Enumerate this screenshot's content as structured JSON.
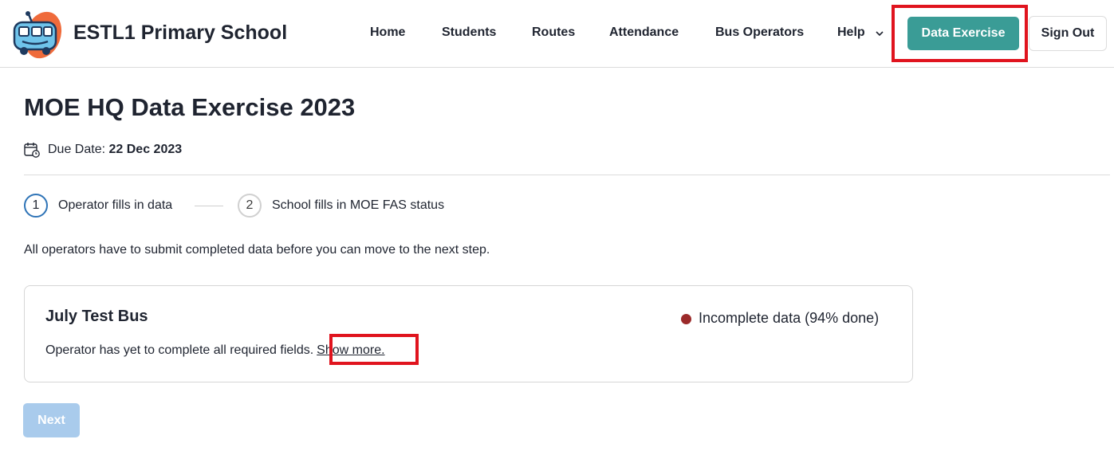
{
  "header": {
    "brand": "ESTL1 Primary School",
    "nav": {
      "home": "Home",
      "students": "Students",
      "routes": "Routes",
      "attendance": "Attendance",
      "bus_operators": "Bus Operators",
      "help": "Help"
    },
    "data_exercise_button": "Data Exercise",
    "sign_out_button": "Sign Out"
  },
  "main": {
    "title": "MOE HQ Data Exercise 2023",
    "due_label": "Due Date:",
    "due_date": "22 Dec 2023",
    "steps": [
      {
        "number": "1",
        "label": "Operator fills in data"
      },
      {
        "number": "2",
        "label": "School fills in MOE FAS status"
      }
    ],
    "info_text": "All operators have to submit completed data before you can move to the next step.",
    "card": {
      "title": "July Test Bus",
      "status_text": "Incomplete data (94% done)",
      "description": "Operator has yet to complete all required fields.",
      "show_more": "Show more."
    },
    "next_button": "Next"
  },
  "colors": {
    "accent_teal": "#3a9c96",
    "highlight_red": "#e0141e",
    "status_dot": "#9b2a2a",
    "step_active": "#2f74b7",
    "next_disabled": "#a9cbec"
  },
  "icons": {
    "logo": "bus-mascot-logo",
    "help_chevron": "chevron-down-icon",
    "due_date": "calendar-clock-icon"
  }
}
